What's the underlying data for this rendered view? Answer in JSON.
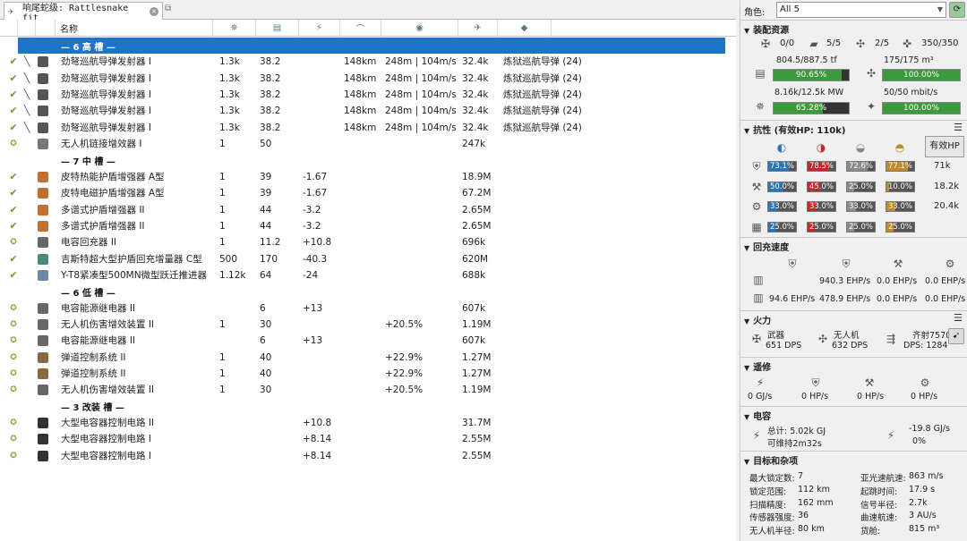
{
  "tab": {
    "title": "响尾蛇级: Rattlesnake fit"
  },
  "columns": {
    "name": "名称"
  },
  "racks": [
    {
      "label": "— 6 高 槽 —",
      "selected": true
    },
    {
      "label": "— 7 中 槽 —"
    },
    {
      "label": "— 6 低 槽 —"
    },
    {
      "label": "— 3 改装 槽 —"
    }
  ],
  "modules": [
    {
      "state": "✔",
      "charge": "╲",
      "icon": "launcher-icon",
      "color": "#555",
      "name": "劲弩巡航导弹发射器 I",
      "c1": "1.3k",
      "c2": "38.2",
      "c3": "",
      "c4": "148km",
      "c5": "248m | 104m/s",
      "c6": "32.4k",
      "c7": "炼狱巡航导弹 (24)"
    },
    {
      "state": "✔",
      "charge": "╲",
      "icon": "launcher-icon",
      "color": "#555",
      "name": "劲弩巡航导弹发射器 I",
      "c1": "1.3k",
      "c2": "38.2",
      "c3": "",
      "c4": "148km",
      "c5": "248m | 104m/s",
      "c6": "32.4k",
      "c7": "炼狱巡航导弹 (24)"
    },
    {
      "state": "✔",
      "charge": "╲",
      "icon": "launcher-icon",
      "color": "#555",
      "name": "劲弩巡航导弹发射器 I",
      "c1": "1.3k",
      "c2": "38.2",
      "c3": "",
      "c4": "148km",
      "c5": "248m | 104m/s",
      "c6": "32.4k",
      "c7": "炼狱巡航导弹 (24)"
    },
    {
      "state": "✔",
      "charge": "╲",
      "icon": "launcher-icon",
      "color": "#555",
      "name": "劲弩巡航导弹发射器 I",
      "c1": "1.3k",
      "c2": "38.2",
      "c3": "",
      "c4": "148km",
      "c5": "248m | 104m/s",
      "c6": "32.4k",
      "c7": "炼狱巡航导弹 (24)"
    },
    {
      "state": "✔",
      "charge": "╲",
      "icon": "launcher-icon",
      "color": "#555",
      "name": "劲弩巡航导弹发射器 I",
      "c1": "1.3k",
      "c2": "38.2",
      "c3": "",
      "c4": "148km",
      "c5": "248m | 104m/s",
      "c6": "32.4k",
      "c7": "炼狱巡航导弹 (24)"
    },
    {
      "state": "✪",
      "charge": "",
      "icon": "drone-link-icon",
      "color": "#777",
      "name": "无人机链接增效器 I",
      "c1": "1",
      "c2": "50",
      "c3": "",
      "c4": "",
      "c5": "",
      "c6": "247k",
      "c7": ""
    },
    {
      "rack": 1
    },
    {
      "state": "✔",
      "charge": "",
      "icon": "shield-amp-icon",
      "color": "#c07030",
      "name": "皮特热能护盾增强器 A型",
      "c1": "1",
      "c2": "39",
      "c3": "-1.67",
      "c4": "",
      "c5": "",
      "c6": "18.9M",
      "c7": ""
    },
    {
      "state": "✔",
      "charge": "",
      "icon": "shield-amp-icon",
      "color": "#c07030",
      "name": "皮特电磁护盾增强器 A型",
      "c1": "1",
      "c2": "39",
      "c3": "-1.67",
      "c4": "",
      "c5": "",
      "c6": "67.2M",
      "c7": ""
    },
    {
      "state": "✔",
      "charge": "",
      "icon": "shield-amp-icon",
      "color": "#c07030",
      "name": "多谱式护盾增强器 II",
      "c1": "1",
      "c2": "44",
      "c3": "-3.2",
      "c4": "",
      "c5": "",
      "c6": "2.65M",
      "c7": ""
    },
    {
      "state": "✔",
      "charge": "",
      "icon": "shield-amp-icon",
      "color": "#c07030",
      "name": "多谱式护盾增强器 II",
      "c1": "1",
      "c2": "44",
      "c3": "-3.2",
      "c4": "",
      "c5": "",
      "c6": "2.65M",
      "c7": ""
    },
    {
      "state": "✪",
      "charge": "",
      "icon": "cap-recharger-icon",
      "color": "#666",
      "name": "电容回充器 II",
      "c1": "1",
      "c2": "11.2",
      "c3": "+10.8",
      "c4": "",
      "c5": "",
      "c6": "696k",
      "c7": ""
    },
    {
      "state": "✔",
      "charge": "",
      "icon": "shield-booster-icon",
      "color": "#4a8a7a",
      "name": "吉斯特超大型护盾回充增量器 C型",
      "c1": "500",
      "c2": "170",
      "c3": "-40.3",
      "c4": "",
      "c5": "",
      "c6": "620M",
      "c7": ""
    },
    {
      "state": "✔",
      "charge": "",
      "icon": "mwd-icon",
      "color": "#6a8aaa",
      "name": "Y-T8紧凑型500MN微型跃迁推进器",
      "c1": "1.12k",
      "c2": "64",
      "c3": "-24",
      "c4": "",
      "c5": "",
      "c6": "688k",
      "c7": ""
    },
    {
      "rack": 2
    },
    {
      "state": "✪",
      "charge": "",
      "icon": "cap-relay-icon",
      "color": "#666",
      "name": "电容能源继电器 II",
      "c1": "",
      "c2": "6",
      "c3": "+13",
      "c4": "",
      "c5": "",
      "c6": "607k",
      "c7": ""
    },
    {
      "state": "✪",
      "charge": "",
      "icon": "drone-damage-icon",
      "color": "#666",
      "name": "无人机伤害增效装置 II",
      "c1": "1",
      "c2": "30",
      "c3": "",
      "c4": "",
      "c5": "+20.5%",
      "c6": "1.19M",
      "c7": ""
    },
    {
      "state": "✪",
      "charge": "",
      "icon": "cap-relay-icon",
      "color": "#666",
      "name": "电容能源继电器 II",
      "c1": "",
      "c2": "6",
      "c3": "+13",
      "c4": "",
      "c5": "",
      "c6": "607k",
      "c7": ""
    },
    {
      "state": "✪",
      "charge": "",
      "icon": "ballistic-control-icon",
      "color": "#8a6a40",
      "name": "弹道控制系统 II",
      "c1": "1",
      "c2": "40",
      "c3": "",
      "c4": "",
      "c5": "+22.9%",
      "c6": "1.27M",
      "c7": ""
    },
    {
      "state": "✪",
      "charge": "",
      "icon": "ballistic-control-icon",
      "color": "#8a6a40",
      "name": "弹道控制系统 II",
      "c1": "1",
      "c2": "40",
      "c3": "",
      "c4": "",
      "c5": "+22.9%",
      "c6": "1.27M",
      "c7": ""
    },
    {
      "state": "✪",
      "charge": "",
      "icon": "drone-damage-icon",
      "color": "#666",
      "name": "无人机伤害增效装置 II",
      "c1": "1",
      "c2": "30",
      "c3": "",
      "c4": "",
      "c5": "+20.5%",
      "c6": "1.19M",
      "c7": ""
    },
    {
      "rack": 3
    },
    {
      "state": "✪",
      "charge": "",
      "icon": "rig-icon",
      "color": "#333",
      "name": "大型电容器控制电路 II",
      "c1": "",
      "c2": "",
      "c3": "+10.8",
      "c4": "",
      "c5": "",
      "c6": "31.7M",
      "c7": ""
    },
    {
      "state": "✪",
      "charge": "",
      "icon": "rig-icon",
      "color": "#333",
      "name": "大型电容器控制电路 I",
      "c1": "",
      "c2": "",
      "c3": "+8.14",
      "c4": "",
      "c5": "",
      "c6": "2.55M",
      "c7": ""
    },
    {
      "state": "✪",
      "charge": "",
      "icon": "rig-icon",
      "color": "#333",
      "name": "大型电容器控制电路 I",
      "c1": "",
      "c2": "",
      "c3": "+8.14",
      "c4": "",
      "c5": "",
      "c6": "2.55M",
      "c7": ""
    }
  ],
  "right": {
    "character_label": "角色:",
    "character_value": "All 5",
    "resources": {
      "title": "装配资源",
      "turrets": "0/0",
      "launchers": "5/5",
      "drones_bay": "2/5",
      "calibration": "350/350",
      "cpu_text": "804.5/887.5 tf",
      "cpu_pct_text": "90.65%",
      "cpu_frac": 0.9065,
      "dronebay_text": "175/175 m³",
      "dronebay_pct_text": "100.00%",
      "dronebay_frac": 1.0,
      "pg_text": "8.16k/12.5k MW",
      "pg_pct_text": "65.28%",
      "pg_frac": 0.6528,
      "bandwidth_text": "50/50 mbit/s",
      "bandwidth_pct_text": "100.00%",
      "bandwidth_frac": 1.0
    },
    "resists": {
      "title": "抗性 (有效HP: 110k)",
      "ehp_button": "有效HP",
      "rows": [
        {
          "vals": [
            "73.1%",
            "78.5%",
            "72.6%",
            "77.1%"
          ],
          "fracs": [
            0.731,
            0.785,
            0.726,
            0.771
          ],
          "ehp": "71k"
        },
        {
          "vals": [
            "50.0%",
            "45.0%",
            "25.0%",
            "10.0%"
          ],
          "fracs": [
            0.5,
            0.45,
            0.25,
            0.1
          ],
          "ehp": "18.2k"
        },
        {
          "vals": [
            "33.0%",
            "33.0%",
            "33.0%",
            "33.0%"
          ],
          "fracs": [
            0.33,
            0.33,
            0.33,
            0.33
          ],
          "ehp": "20.4k"
        },
        {
          "vals": [
            "25.0%",
            "25.0%",
            "25.0%",
            "25.0%"
          ],
          "fracs": [
            0.25,
            0.25,
            0.25,
            0.25
          ],
          "ehp": ""
        }
      ],
      "colors": [
        "#2a74b8",
        "#c02a2a",
        "#8a8a8a",
        "#c08a2a"
      ]
    },
    "recharge": {
      "title": "回充速度",
      "row1": [
        "940.3 EHP/s",
        "0.0 EHP/s",
        "0.0 EHP/s"
      ],
      "row2": [
        "94.6 EHP/s",
        "478.9 EHP/s",
        "0.0 EHP/s",
        "0.0 EHP/s"
      ]
    },
    "firepower": {
      "title": "火力",
      "weapon_label": "武器",
      "weapon_dps": "651 DPS",
      "drone_label": "无人机",
      "drone_dps": "632 DPS",
      "volley_label": "齐射7570",
      "total_dps": "DPS: 1284"
    },
    "remote": {
      "title": "遥修",
      "vals": [
        "0 GJ/s",
        "0 HP/s",
        "0 HP/s",
        "0 HP/s"
      ]
    },
    "capacitor": {
      "title": "电容",
      "total": "总计: 5.02k GJ",
      "lasts": "可维持2m32s",
      "delta": "-19.8 GJ/s",
      "pct": "0%"
    },
    "misc": {
      "title": "目标和杂项",
      "left": [
        {
          "k": "最大锁定数:",
          "v": "7"
        },
        {
          "k": "锁定范围:",
          "v": "112 km"
        },
        {
          "k": "扫描精度:",
          "v": "162 mm"
        },
        {
          "k": "传感器强度:",
          "v": "36"
        },
        {
          "k": "无人机半径:",
          "v": "80 km"
        }
      ],
      "right": [
        {
          "k": "亚光速航速:",
          "v": "863 m/s"
        },
        {
          "k": "起跳时间:",
          "v": "17.9 s"
        },
        {
          "k": "信号半径:",
          "v": "2.7k"
        },
        {
          "k": "曲速航速:",
          "v": "3 AU/s"
        },
        {
          "k": "货舱:",
          "v": "815 m³"
        }
      ]
    }
  }
}
